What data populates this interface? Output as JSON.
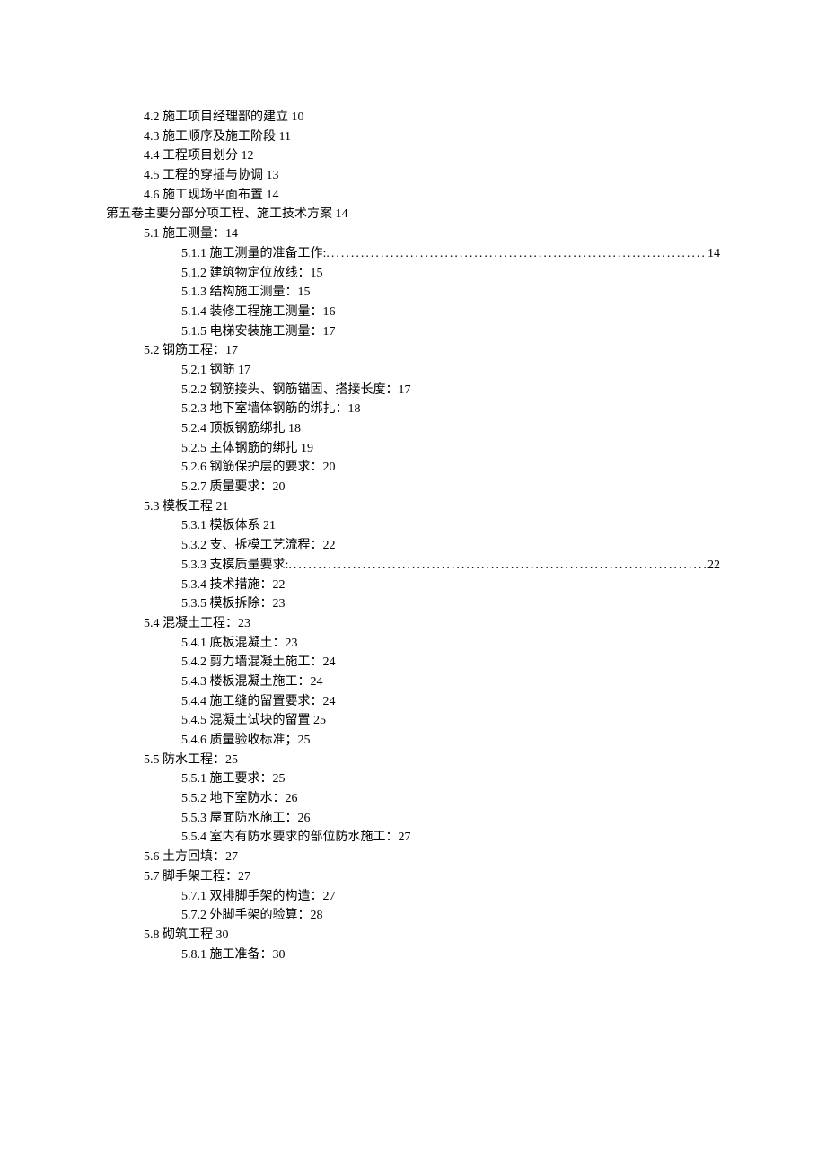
{
  "toc": {
    "e42": {
      "text": "4.2 施工项目经理部的建立 10"
    },
    "e43": {
      "text": "4.3 施工顺序及施工阶段 11"
    },
    "e44": {
      "text": "4.4 工程项目划分 12"
    },
    "e45": {
      "text": "4.5  工程的穿插与协调 13"
    },
    "e46": {
      "text": "4.6 施工现场平面布置 14"
    },
    "vol5": {
      "text": "第五卷主要分部分项工程、施工技术方案 14"
    },
    "e51": {
      "text": "5.1 施工测量：14"
    },
    "e511": {
      "label": "5.1.1 施工测量的准备工作:",
      "page": "14"
    },
    "e512": {
      "text": "5.1.2 建筑物定位放线：15"
    },
    "e513": {
      "text": "5.1.3 结构施工测量：15"
    },
    "e514": {
      "text": "5.1.4 装修工程施工测量：16"
    },
    "e515": {
      "text": "5.1.5 电梯安装施工测量：17"
    },
    "e52": {
      "text": "5.2 钢筋工程：17"
    },
    "e521": {
      "text": "5.2.1 钢筋 17"
    },
    "e522": {
      "text": "5.2.2 钢筋接头、钢筋锚固、搭接长度：17"
    },
    "e523": {
      "text": "5.2.3 地下室墙体钢筋的绑扎：18"
    },
    "e524": {
      "text": "5.2.4 顶板钢筋绑扎 18"
    },
    "e525": {
      "text": "5.2.5 主体钢筋的绑扎 19"
    },
    "e526": {
      "text": "5.2.6 钢筋保护层的要求：20"
    },
    "e527": {
      "text": "5.2.7 质量要求：20"
    },
    "e53": {
      "text": "5.3 模板工程 21"
    },
    "e531": {
      "text": "5.3.1 模板体系 21"
    },
    "e532": {
      "text": "5.3.2 支、拆模工艺流程：22"
    },
    "e533": {
      "label": "5.3.3 支模质量要求:",
      "page": "22"
    },
    "e534": {
      "text": "5.3.4 技术措施：22"
    },
    "e535": {
      "text": "5.3.5 模板拆除：23"
    },
    "e54": {
      "text": "5.4 混凝土工程：23"
    },
    "e541": {
      "text": "5.4.1 底板混凝土：23"
    },
    "e542": {
      "text": "5.4.2 剪力墙混凝土施工：24"
    },
    "e543": {
      "text": "5.4.3 楼板混凝土施工：24"
    },
    "e544": {
      "text": "5.4.4 施工缝的留置要求：24"
    },
    "e545": {
      "text": "5.4.5 混凝土试块的留置 25"
    },
    "e546": {
      "text": "5.4.6 质量验收标准；25"
    },
    "e55": {
      "text": "5.5 防水工程：25"
    },
    "e551": {
      "text": "5.5.1 施工要求：25"
    },
    "e552": {
      "text": "5.5.2 地下室防水：26"
    },
    "e553": {
      "text": "5.5.3 屋面防水施工：26"
    },
    "e554": {
      "text": "5.5.4 室内有防水要求的部位防水施工：27"
    },
    "e56": {
      "text": "5.6 土方回填：27"
    },
    "e57": {
      "text": "5.7 脚手架工程：27"
    },
    "e571": {
      "text": "5.7.1 双排脚手架的构造：27"
    },
    "e572": {
      "text": "5.7.2 外脚手架的验算：28"
    },
    "e58": {
      "text": "5.8 砌筑工程 30"
    },
    "e581": {
      "text": "5.8.1 施工准备：30"
    }
  },
  "dots": "................................................................................................................................................................"
}
